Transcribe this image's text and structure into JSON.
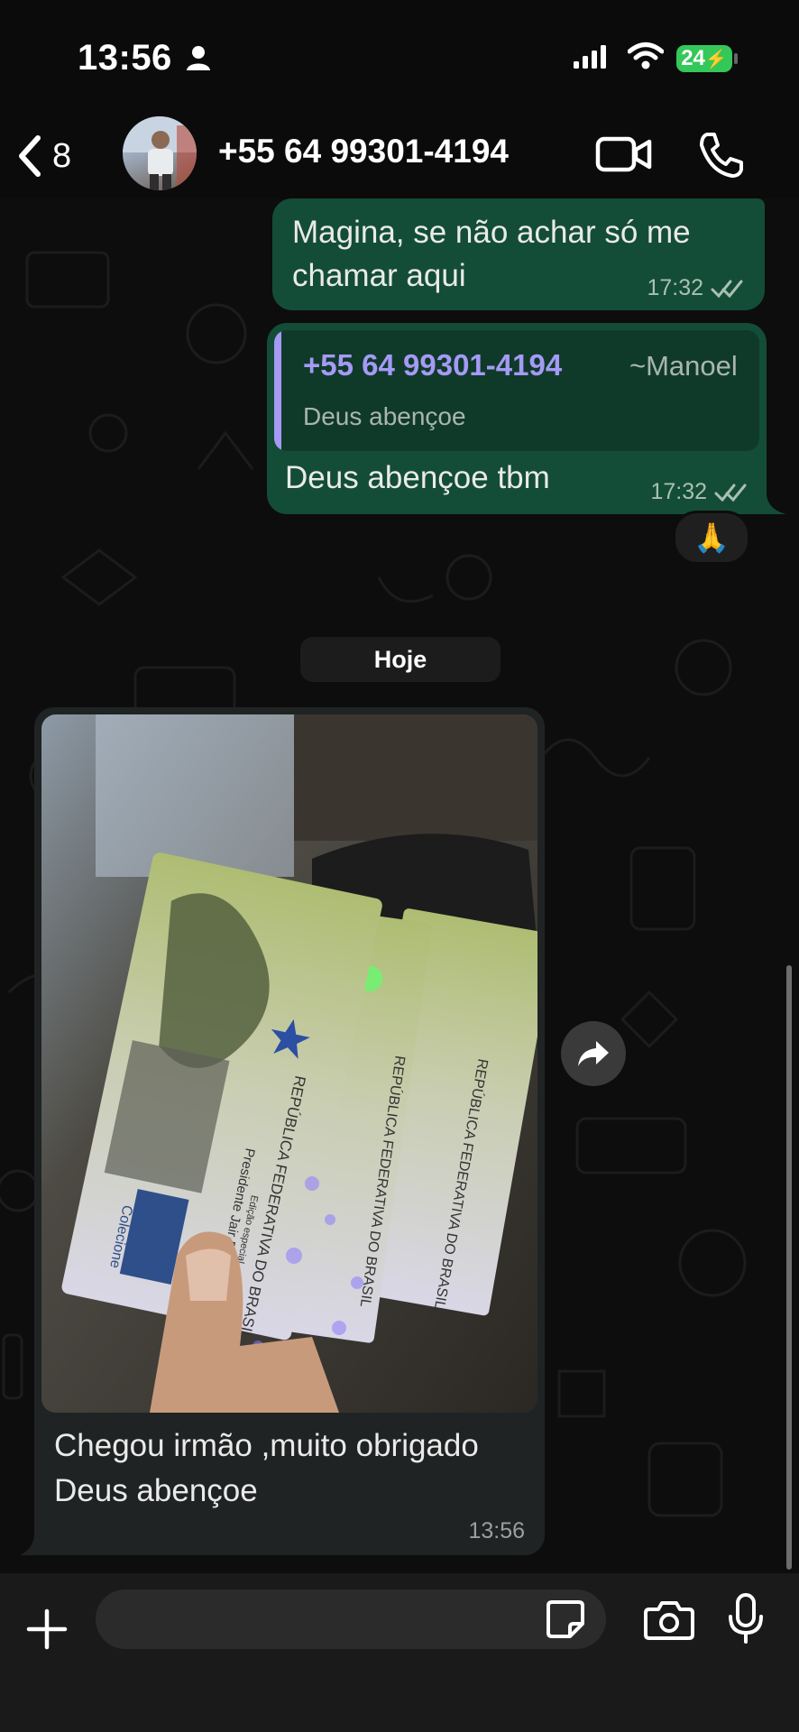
{
  "status_bar": {
    "time": "13:56",
    "battery": "24"
  },
  "header": {
    "back_count": "8",
    "contact_name": "+55 64 99301-4194"
  },
  "messages": [
    {
      "direction": "out",
      "text": "Magina, se não achar só me chamar aqui",
      "time": "17:32",
      "status": "read"
    },
    {
      "direction": "out",
      "quote": {
        "sender": "+55 64 99301-4194",
        "alias": "~Manoel",
        "text": "Deus abençoe"
      },
      "text": "Deus abençoe tbm",
      "time": "17:32",
      "status": "read",
      "reaction": "🙏"
    }
  ],
  "date_separator": "Hoje",
  "incoming": {
    "caption": "Chegou irmão ,muito obrigado Deus abençoe",
    "time": "13:56",
    "photo_text": {
      "line1": "REPÚBLICA FEDERATIVA DO BRASIL",
      "line2": "Edição especial",
      "line3": "Presidente Jair Bolsonaro",
      "line4": "Colecione"
    }
  },
  "composer": {
    "placeholder": ""
  },
  "icons": {
    "back": "chevron-left-icon",
    "video": "video-camera-icon",
    "call": "phone-icon",
    "forward": "forward-icon",
    "plus": "plus-icon",
    "sticker": "sticker-icon",
    "camera": "camera-icon",
    "mic": "microphone-icon",
    "read": "double-check-icon"
  },
  "colors": {
    "outgoing_bubble": "#144d37",
    "incoming_bubble": "#202323",
    "quote_accent": "#a59af5",
    "battery": "#34c759",
    "background": "#0b0b0b"
  }
}
